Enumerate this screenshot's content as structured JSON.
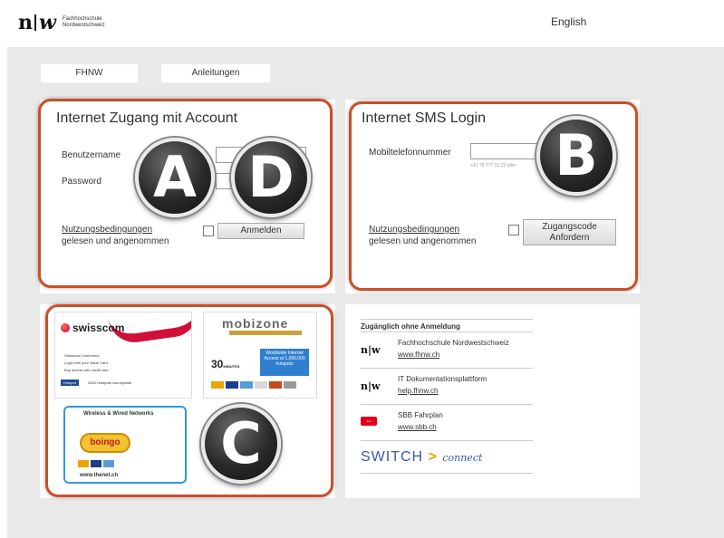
{
  "header": {
    "logo_letters_n": "n",
    "logo_letters_w": "w",
    "logo_line1": "Fachhochschule",
    "logo_line2": "Nordwestschweiz",
    "language_link": "English"
  },
  "nav": {
    "fhnw_label": "FHNW",
    "anleitungen_label": "Anleitungen"
  },
  "account_card": {
    "title": "Internet Zugang mit Account",
    "username_label": "Benutzername",
    "password_label": "Password",
    "terms_link": "Nutzungsbedingungen",
    "terms_suffix": "gelesen und angenommen",
    "login_button": "Anmelden"
  },
  "sms_card": {
    "title": "Internet SMS Login",
    "mobile_label": "Mobiltelefonnummer",
    "mobile_hint": "+41 79 777 33 22 oder",
    "terms_link": "Nutzungsbedingungen",
    "terms_suffix": "gelesen und angenommen",
    "request_button_line1": "Zugangscode",
    "request_button_line2": "Anfordern"
  },
  "badges": {
    "a": "A",
    "d": "D",
    "b": "B",
    "c": "C"
  },
  "ads": {
    "swisscom": {
      "brand": "swisscom",
      "line1": "Swisscom Customers",
      "line2": "Login with your Value Card",
      "line3": "Buy access with credit card",
      "hotspot": "Hotspot",
      "hotspot_text": "2000 Hotspots countrywide"
    },
    "mobizone": {
      "brand": "mobizone",
      "minutes": "30",
      "minutes_unit": "MINUTES",
      "box_text": "Worldwide Internet Access at 1,000,000 hotspots"
    },
    "boingo": {
      "heading": "Wireless & Wired Networks",
      "brand": "boingo",
      "url": "www.thenet.ch"
    }
  },
  "free_access": {
    "title": "Zugänglich ohne Anmeldung",
    "items": [
      {
        "name": "Fachhochschule Nordwestschweiz",
        "url": "www.fhnw.ch"
      },
      {
        "name": "IT Dokumentationsplattform",
        "url": "help.fhnw.ch"
      },
      {
        "name": "SBB Fahrplan",
        "url": "www.sbb.ch"
      }
    ],
    "switch_brand": "SWITCH",
    "switch_arrow": ">",
    "switch_connect": "connect",
    "sbb_symbol": "⇔"
  },
  "colors": {
    "highlight": "#c8502a",
    "background": "#e9e9e9"
  }
}
